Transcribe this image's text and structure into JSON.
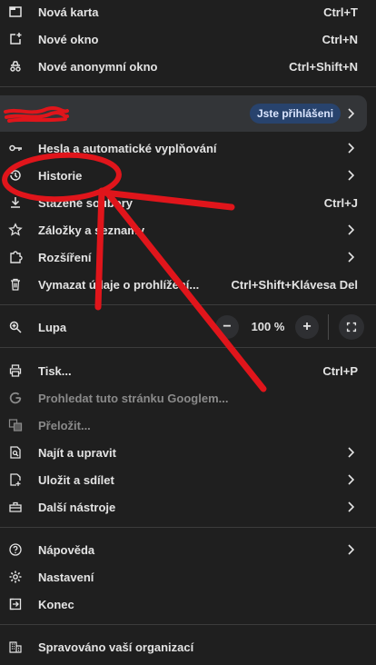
{
  "menu": {
    "new_tab": {
      "label": "Nová karta",
      "shortcut": "Ctrl+T"
    },
    "new_window": {
      "label": "Nové okno",
      "shortcut": "Ctrl+N"
    },
    "incognito": {
      "label": "Nové anonymní okno",
      "shortcut": "Ctrl+Shift+N"
    },
    "profile": {
      "badge": "Jste přihlášeni"
    },
    "passwords": {
      "label": "Hesla a automatické vyplňování"
    },
    "history": {
      "label": "Historie"
    },
    "downloads": {
      "label": "Stažené soubory",
      "shortcut": "Ctrl+J"
    },
    "bookmarks": {
      "label": "Záložky a seznamy"
    },
    "extensions": {
      "label": "Rozšíření"
    },
    "clear_data": {
      "label": "Vymazat údaje o prohlížení...",
      "shortcut": "Ctrl+Shift+Klávesa Del"
    },
    "zoom": {
      "label": "Lupa",
      "minus": "−",
      "value": "100 %",
      "plus": "+"
    },
    "print": {
      "label": "Tisk...",
      "shortcut": "Ctrl+P"
    },
    "search_page": {
      "label": "Prohledat tuto stránku Googlem..."
    },
    "translate": {
      "label": "Přeložit..."
    },
    "find_edit": {
      "label": "Najít a upravit"
    },
    "save_share": {
      "label": "Uložit a sdílet"
    },
    "more_tools": {
      "label": "Další nástroje"
    },
    "help": {
      "label": "Nápověda"
    },
    "settings": {
      "label": "Nastavení"
    },
    "exit": {
      "label": "Konec"
    },
    "managed": {
      "label": "Spravováno vaší organizací"
    }
  },
  "colors": {
    "background": "#1f1f1f",
    "text": "#e3e3e3",
    "annotation": "#e0151b",
    "badge": "#28436d"
  }
}
